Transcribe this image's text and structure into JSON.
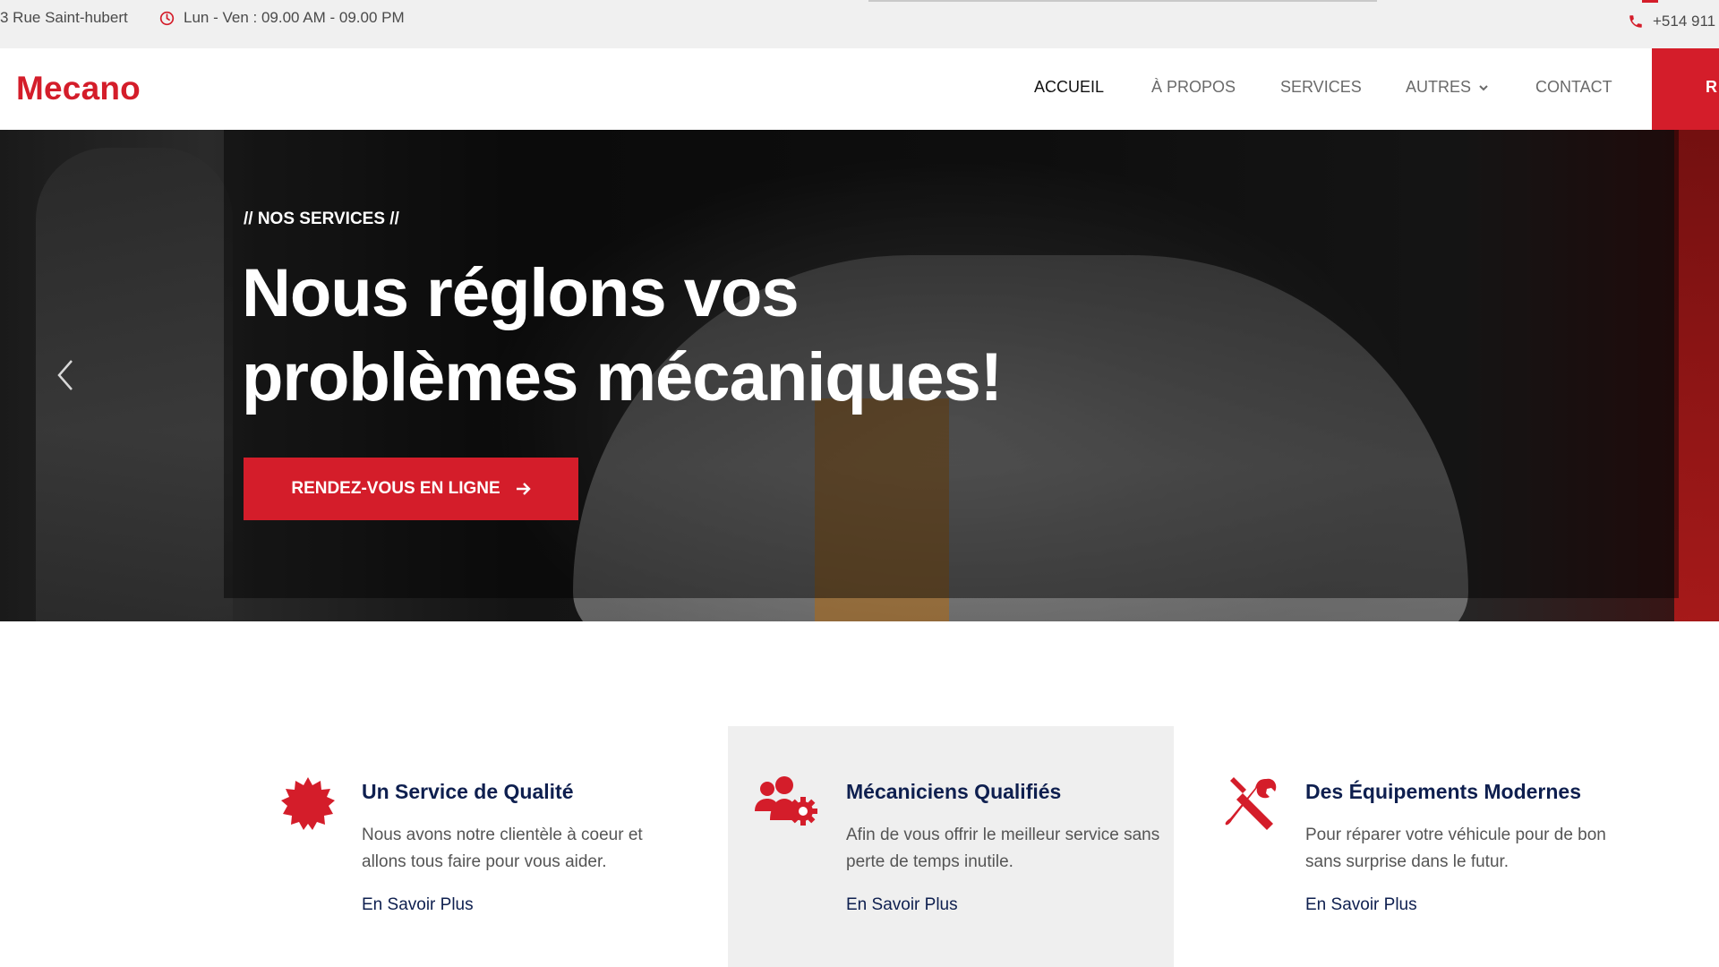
{
  "topbar": {
    "address": "3 Rue Saint-hubert",
    "hours": "Lun - Ven : 09.00 AM - 09.00 PM",
    "phone": "+514 911"
  },
  "nav": {
    "logo": "Mecano",
    "items": [
      {
        "label": "ACCUEIL",
        "active": true
      },
      {
        "label": "À PROPOS",
        "active": false
      },
      {
        "label": "SERVICES",
        "active": false
      },
      {
        "label": "AUTRES",
        "active": false,
        "dropdown": true
      },
      {
        "label": "CONTACT",
        "active": false
      }
    ],
    "cta_partial": "R"
  },
  "hero": {
    "kicker": "// NOS SERVICES //",
    "title": "Nous réglons vos problèmes mécaniques!",
    "button": "RENDEZ-VOUS EN LIGNE"
  },
  "features": [
    {
      "icon": "badge-star-icon",
      "title": "Un Service de Qualité",
      "description": "Nous avons notre clientèle à coeur et allons tous faire pour vous aider.",
      "link": "En Savoir Plus"
    },
    {
      "icon": "users-gear-icon",
      "title": "Mécaniciens Qualifiés",
      "description": "Afin de vous offrir le meilleur service sans perte de temps inutile.",
      "link": "En Savoir Plus"
    },
    {
      "icon": "tools-icon",
      "title": "Des Équipements Modernes",
      "description": "Pour réparer votre véhicule pour de bon sans surprise dans le futur.",
      "link": "En Savoir Plus"
    }
  ],
  "colors": {
    "brand_red": "#d41d2a",
    "navy": "#0e1f4f",
    "topbar_bg": "#f0f0f0"
  }
}
